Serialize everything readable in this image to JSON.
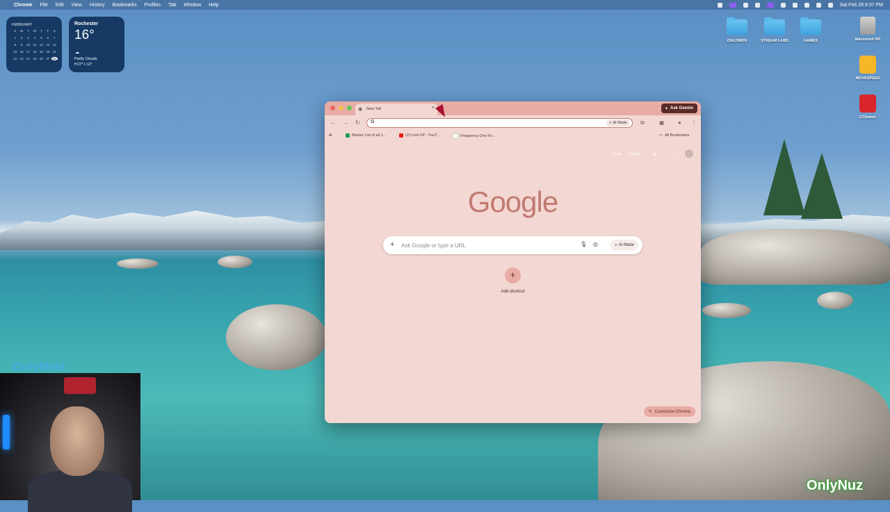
{
  "menubar": {
    "app": "Chrome",
    "items": [
      "File",
      "Edit",
      "View",
      "History",
      "Bookmarks",
      "Profiles",
      "Tab",
      "Window",
      "Help"
    ],
    "datetime": "Sat Feb 28 9:37 PM"
  },
  "calendar": {
    "month": "FEBRUARY",
    "weekdays": [
      "S",
      "M",
      "T",
      "W",
      "T",
      "F",
      "S"
    ],
    "days": [
      "1",
      "2",
      "3",
      "4",
      "5",
      "6",
      "7",
      "8",
      "9",
      "10",
      "11",
      "12",
      "13",
      "14",
      "15",
      "16",
      "17",
      "18",
      "19",
      "20",
      "21",
      "22",
      "23",
      "24",
      "25",
      "26",
      "27",
      "28"
    ],
    "today": "28"
  },
  "weather": {
    "city": "Rochester",
    "temp": "16°",
    "condition": "Partly Cloudy",
    "hilo": "H:27° L:12°"
  },
  "desktop_icons": [
    "ONLYMIDS",
    "STREAM LABS",
    "GAMES",
    "Macintosh HD",
    "MOVESPEED",
    "CCleaner"
  ],
  "browser": {
    "tab_title": "New Tab",
    "ask_gemini": "Ask Gemini",
    "omnibox_ai_mode": "AI Mode",
    "bookmarks": [
      "Master List of all J...",
      "(2) Lord VP - YouT...",
      "Frequency One Fe..."
    ],
    "all_bookmarks": "All Bookmarks",
    "ntp_links": [
      "Gmail",
      "Images"
    ],
    "logo": "Google",
    "search_placeholder": "Ask Google or type a URL",
    "search_ai_mode": "AI Mode",
    "add_shortcut": "Add shortcut",
    "customize": "Customize Chrome"
  },
  "watermarks": {
    "top": "OnlyMids",
    "bottom": "OnlyNuz"
  },
  "colors": {
    "window_bg": "#f3d7d2",
    "titlebar": "#e8aca5",
    "accent": "#c27a71"
  }
}
